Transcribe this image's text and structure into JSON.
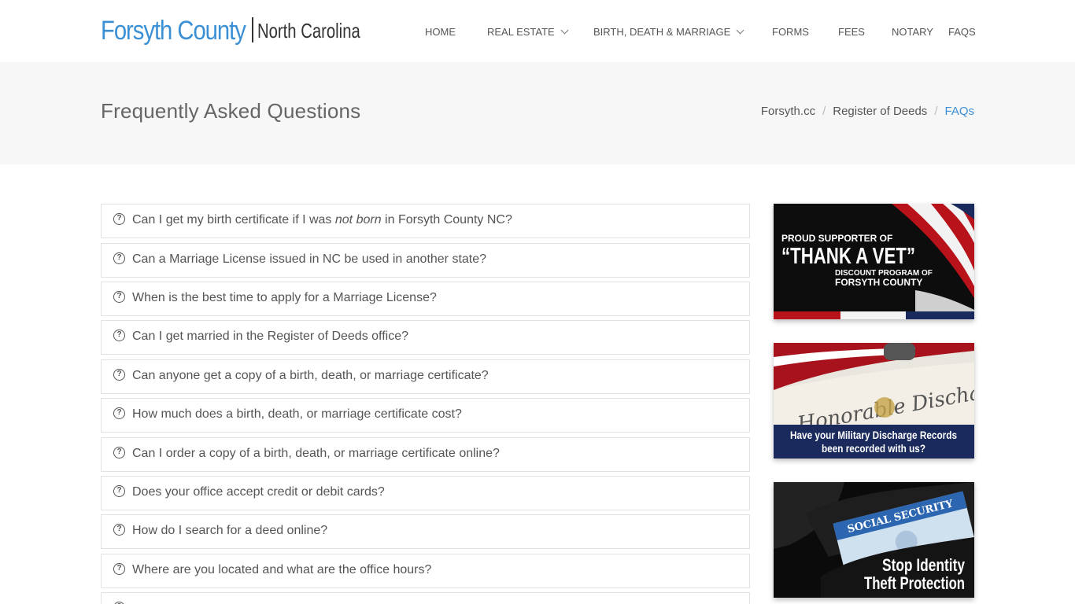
{
  "brand": {
    "title": "Forsyth County",
    "subtitle": "North Carolina",
    "accent": "#3b8fd5"
  },
  "nav": {
    "home": "HOME",
    "real_estate": "REAL ESTATE",
    "bdm": "BIRTH, DEATH & MARRIAGE",
    "forms": "FORMS",
    "fees": "FEES",
    "notary": "NOTARY",
    "faqs": "FAQS"
  },
  "page": {
    "title": "Frequently Asked Questions"
  },
  "breadcrumb": {
    "items": [
      "Forsyth.cc",
      "Register of Deeds",
      "FAQs"
    ],
    "separator": "/"
  },
  "faqs": {
    "q0_pre": "Can I get my birth certificate if I was ",
    "q0_em": "not born",
    "q0_post": " in Forsyth County NC?",
    "items": [
      "Can a Marriage License issued in NC be used in another state?",
      "When is the best time to apply for a Marriage License?",
      "Can I get married in the Register of Deeds office?",
      "Can anyone get a copy of a birth, death, or marriage certificate?",
      "How much does a birth, death, or marriage certificate cost?",
      "Can I order a copy of a birth, death, or marriage certificate online?",
      "Does your office accept credit or debit cards?",
      "How do I search for a deed online?",
      "Where are you located and what are the office hours?"
    ],
    "icon": "question-circle-icon"
  },
  "ads": {
    "vet": {
      "line1": "PROUD SUPPORTER OF",
      "line2": "“THANK A VET”",
      "line3": "DISCOUNT PROGRAM OF",
      "line4": "FORSYTH COUNTY"
    },
    "discharge": {
      "script": "Honorable Discharge",
      "line1": "Have your Military Discharge Records",
      "line2": "been recorded with us?"
    },
    "identity": {
      "card": "SOCIAL SECURITY",
      "line1": "Stop Identity",
      "line2": "Theft Protection"
    }
  }
}
